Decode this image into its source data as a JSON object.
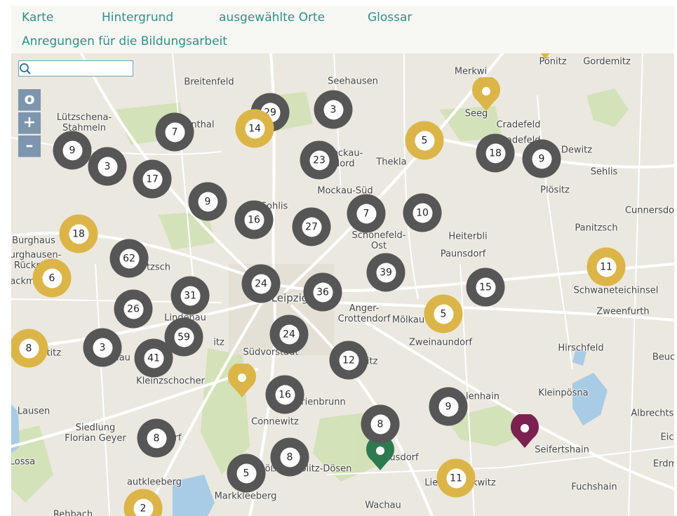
{
  "nav": {
    "items": [
      "Karte",
      "Hintergrund",
      "ausgewählte Orte",
      "Glossar",
      "Anregungen für die Bildungsarbeit"
    ]
  },
  "search": {
    "placeholder": ""
  },
  "controls": {
    "locate": "o",
    "zoom_in": "+",
    "zoom_out": "–"
  },
  "colors": {
    "grey_cluster": "#565656",
    "gold_cluster": "#dcb548",
    "green_pin": "#2e7a50",
    "purple_pin": "#7b2150",
    "nav_link": "#2f8f88"
  },
  "places": [
    "Pönitz",
    "Gordemitz",
    "Merkwi",
    "Breitenfeld",
    "Seehausen",
    "Lützschena-\nStahmeln",
    "Seeg",
    "Cradefeld",
    "Dewitz",
    "Sehlis",
    "Plösitz",
    "Thekla",
    "Mockau-Süd",
    "Cunnersdo",
    "Panitzsch",
    "Burghaus",
    "Burghausen-\nRückma",
    "Heiterbli",
    "Paunsdorf",
    "Schönefeld-\nOst",
    "Schwaneteichinsel",
    "Zweenfurth",
    "Leipzig",
    "Anger-\nCrottendorf",
    "Mölkau",
    "Zweinaundorf",
    "Lindenau",
    "Südvorstadt",
    "Hirschfeld",
    "Beuc",
    "Kleinzschocher",
    "Kleinpösna",
    "Lausen",
    "Albrechtsh",
    "Siedlung\nFlorian Geyer",
    "Connewitz",
    "Seifertshain",
    "Eic",
    "Erdm",
    "Lößnig-Dölitz-Dösen",
    "Fuchshain",
    "Liebertwolkwitz",
    "Markkleeberg",
    "Wachau",
    "Rehbach",
    "autkleeberg",
    "ackm",
    "Lossa",
    "Cradefeld",
    "Mockau-\nNord",
    "Sohlis",
    "ritz",
    "rienbrunn",
    "usdorf",
    "sdorf",
    "altitz",
    "lau",
    "tzsch",
    "itz",
    "ttinthal",
    "lenhain"
  ],
  "clusters": [
    {
      "count": "29",
      "kind": "grey"
    },
    {
      "count": "3",
      "kind": "grey"
    },
    {
      "count": "14",
      "kind": "gold"
    },
    {
      "count": "7",
      "kind": "grey"
    },
    {
      "count": "5",
      "kind": "gold"
    },
    {
      "count": "9",
      "kind": "grey"
    },
    {
      "count": "3",
      "kind": "grey"
    },
    {
      "count": "23",
      "kind": "grey"
    },
    {
      "count": "18",
      "kind": "grey"
    },
    {
      "count": "9",
      "kind": "grey"
    },
    {
      "count": "17",
      "kind": "grey"
    },
    {
      "count": "9",
      "kind": "grey"
    },
    {
      "count": "16",
      "kind": "grey"
    },
    {
      "count": "27",
      "kind": "grey"
    },
    {
      "count": "7",
      "kind": "grey"
    },
    {
      "count": "10",
      "kind": "grey"
    },
    {
      "count": "18",
      "kind": "gold"
    },
    {
      "count": "62",
      "kind": "grey"
    },
    {
      "count": "6",
      "kind": "gold"
    },
    {
      "count": "24",
      "kind": "grey"
    },
    {
      "count": "36",
      "kind": "grey"
    },
    {
      "count": "39",
      "kind": "grey"
    },
    {
      "count": "15",
      "kind": "grey"
    },
    {
      "count": "11",
      "kind": "gold"
    },
    {
      "count": "26",
      "kind": "grey"
    },
    {
      "count": "31",
      "kind": "grey"
    },
    {
      "count": "5",
      "kind": "gold"
    },
    {
      "count": "59",
      "kind": "grey"
    },
    {
      "count": "24",
      "kind": "grey"
    },
    {
      "count": "8",
      "kind": "gold"
    },
    {
      "count": "3",
      "kind": "grey"
    },
    {
      "count": "41",
      "kind": "grey"
    },
    {
      "count": "12",
      "kind": "grey"
    },
    {
      "count": "16",
      "kind": "grey"
    },
    {
      "count": "9",
      "kind": "grey"
    },
    {
      "count": "8",
      "kind": "grey"
    },
    {
      "count": "8",
      "kind": "grey"
    },
    {
      "count": "8",
      "kind": "grey"
    },
    {
      "count": "5",
      "kind": "grey"
    },
    {
      "count": "11",
      "kind": "gold"
    },
    {
      "count": "2",
      "kind": "gold"
    }
  ],
  "pins": [
    {
      "name": "gold-pin-top",
      "color": "#dcb548"
    },
    {
      "name": "gold-pin-center",
      "color": "#dcb548"
    },
    {
      "name": "green-pin",
      "color": "#2e7a50"
    },
    {
      "name": "purple-pin",
      "color": "#7b2150"
    },
    {
      "name": "gold-pin-partial",
      "color": "#dcb548"
    }
  ]
}
